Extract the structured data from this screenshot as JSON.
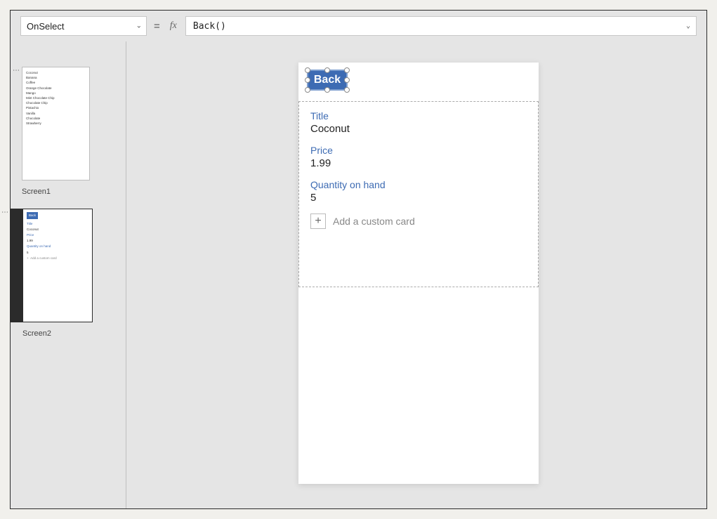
{
  "formula_bar": {
    "property": "OnSelect",
    "equals": "=",
    "fx": "fx",
    "formula": "Back()"
  },
  "thumbnails": {
    "screen1": {
      "label": "Screen1",
      "items": [
        "Coconut",
        "Banana",
        "Coffee",
        "Orange Chocolate",
        "Mango",
        "Mint Chocolate Chip",
        "Chocolate Chip",
        "Pistachio",
        "Vanilla",
        "Chocolate",
        "Strawberry"
      ]
    },
    "screen2": {
      "label": "Screen2",
      "back": "Back",
      "title_label": "Title",
      "title_value": "Coconut",
      "price_label": "Price",
      "price_value": "1.99",
      "qty_label": "Quantity on hand",
      "qty_value": "5",
      "add_plus": "+",
      "add_text": "Add a custom card"
    }
  },
  "canvas": {
    "back_label": "Back",
    "fields": {
      "title_label": "Title",
      "title_value": "Coconut",
      "price_label": "Price",
      "price_value": "1.99",
      "qty_label": "Quantity on hand",
      "qty_value": "5"
    },
    "add_card": {
      "plus": "+",
      "text": "Add a custom card"
    }
  }
}
